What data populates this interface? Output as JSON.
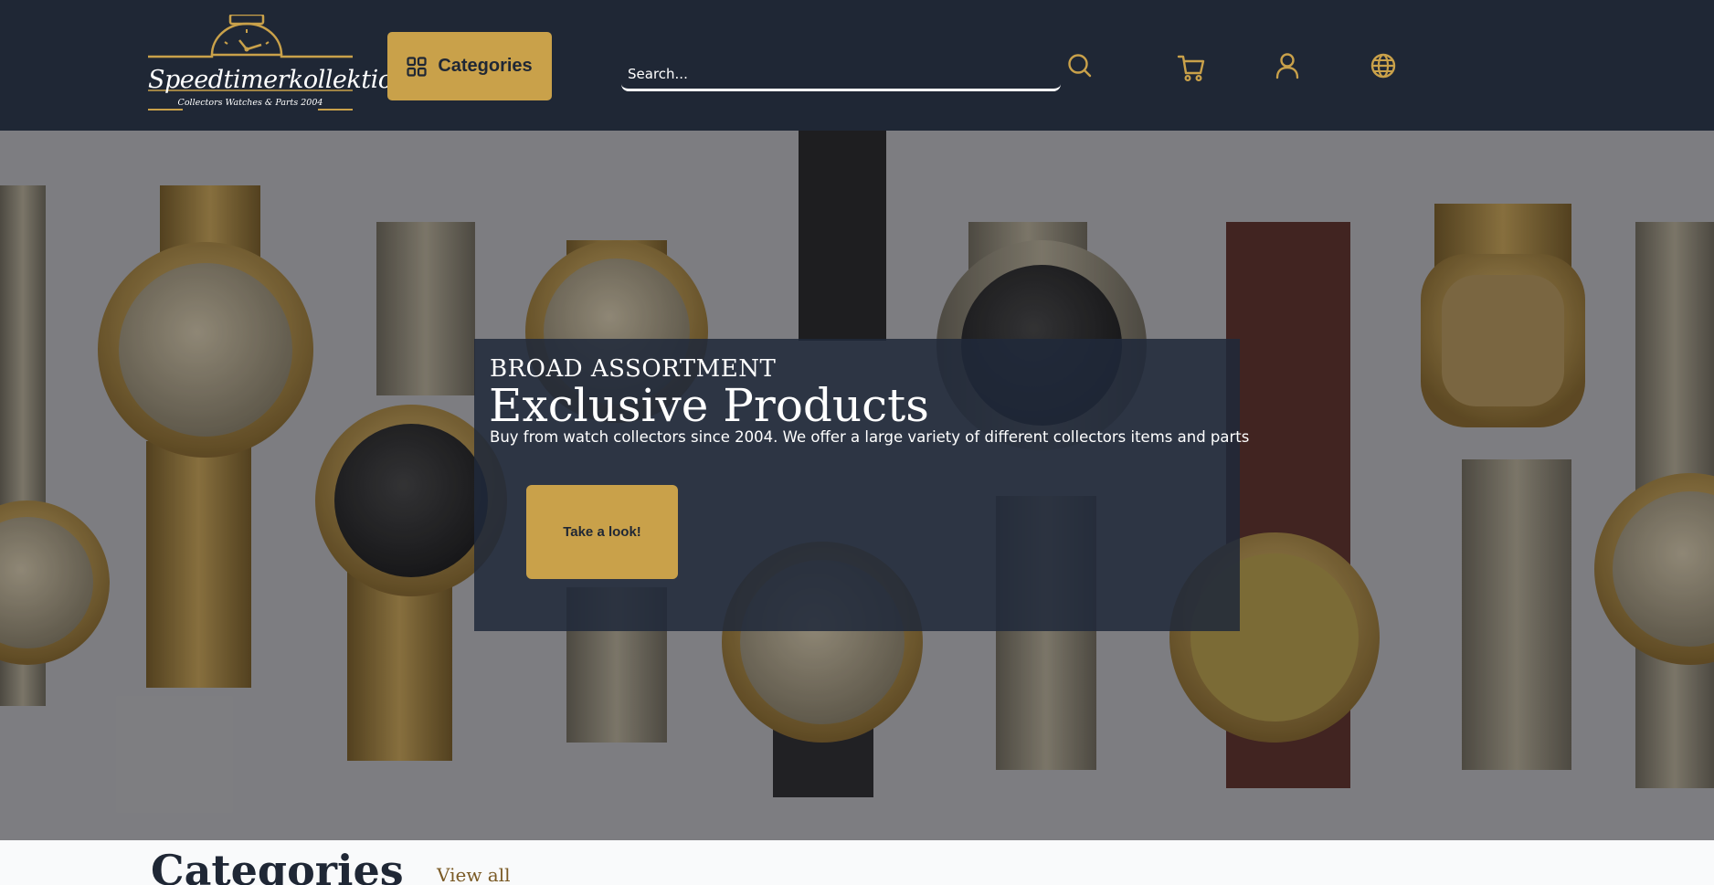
{
  "header": {
    "logo": {
      "name": "Speedtimerkollektion",
      "tagline": "Collectors Watches & Parts 2004"
    },
    "categories_button": {
      "label": "Categories",
      "icon": "grid-icon"
    },
    "search": {
      "placeholder": "Search...",
      "value": "",
      "icon": "search-icon"
    },
    "icons": [
      "cart-icon",
      "user-icon",
      "globe-icon"
    ]
  },
  "hero": {
    "eyebrow": "BROAD ASSORTMENT",
    "title": "Exclusive Products",
    "description": "Buy from watch collectors since 2004. We offer a large variety of different collectors items and parts",
    "cta_label": "Take a look!"
  },
  "categories_section": {
    "title": "Categories",
    "view_all": "View all"
  },
  "colors": {
    "header_bg": "#1f2735",
    "accent": "#c9a14a",
    "overlay": "#1f293a",
    "text_light": "#ffffff",
    "link": "#7a5a25"
  }
}
